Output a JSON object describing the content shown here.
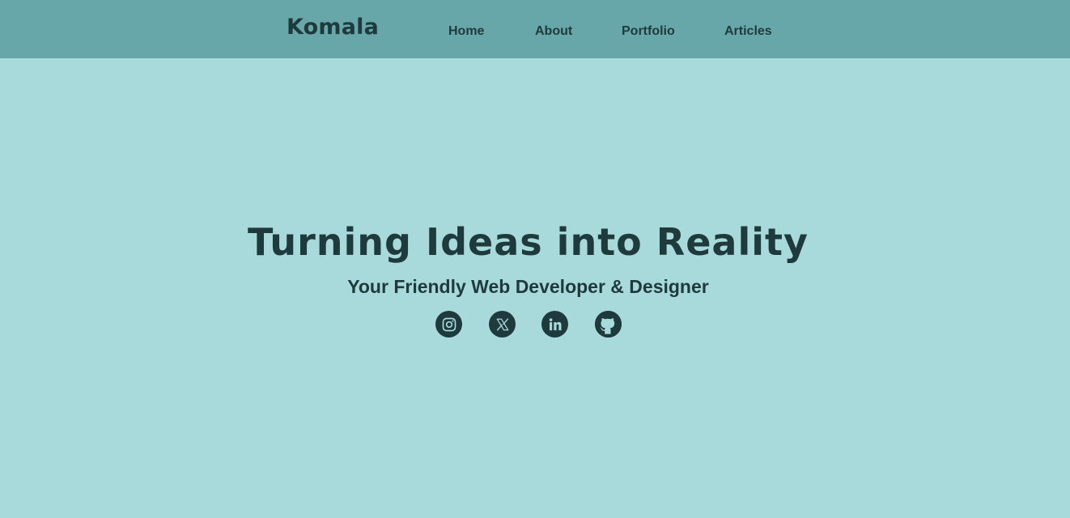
{
  "brand": {
    "name": "Komala"
  },
  "nav": {
    "items": [
      {
        "label": "Home"
      },
      {
        "label": "About"
      },
      {
        "label": "Portfolio"
      },
      {
        "label": "Articles"
      }
    ]
  },
  "hero": {
    "headline": "Turning Ideas into Reality",
    "subheadline": "Your Friendly Web Developer & Designer"
  },
  "social": {
    "icons": [
      "instagram-icon",
      "x-icon",
      "linkedin-icon",
      "github-icon"
    ]
  },
  "colors": {
    "background": "#a8dadc",
    "navbar": "#67a7a9",
    "text": "#1f3a3d"
  }
}
